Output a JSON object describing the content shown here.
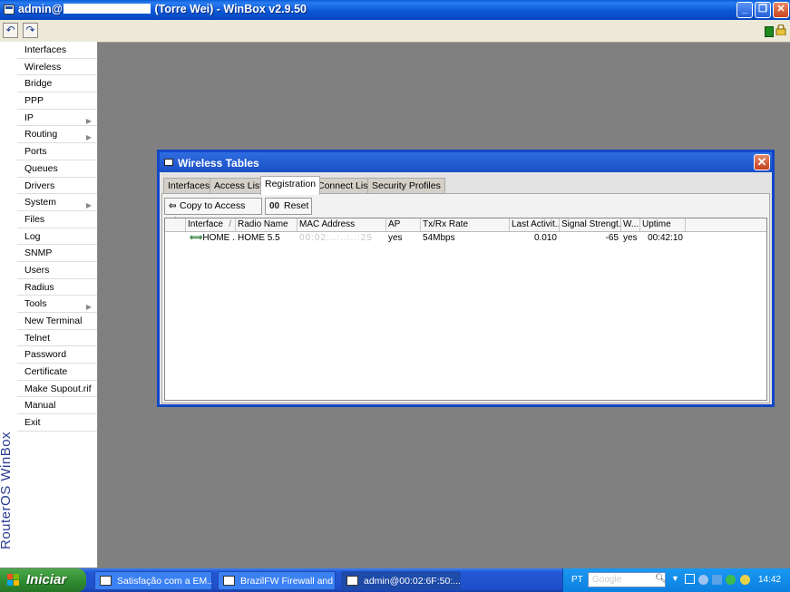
{
  "window": {
    "title_prefix": "admin@",
    "title_suffix": " (Torre Wei) - WinBox v2.9.50"
  },
  "toolbar": {
    "undo_glyph": "↶",
    "redo_glyph": "↷"
  },
  "brand": "RouterOS WinBox",
  "menu": [
    {
      "label": "Interfaces",
      "sub": false
    },
    {
      "label": "Wireless",
      "sub": false
    },
    {
      "label": "Bridge",
      "sub": false
    },
    {
      "label": "PPP",
      "sub": false
    },
    {
      "label": "IP",
      "sub": true
    },
    {
      "label": "Routing",
      "sub": true
    },
    {
      "label": "Ports",
      "sub": false
    },
    {
      "label": "Queues",
      "sub": false
    },
    {
      "label": "Drivers",
      "sub": false
    },
    {
      "label": "System",
      "sub": true
    },
    {
      "label": "Files",
      "sub": false
    },
    {
      "label": "Log",
      "sub": false
    },
    {
      "label": "SNMP",
      "sub": false
    },
    {
      "label": "Users",
      "sub": false
    },
    {
      "label": "Radius",
      "sub": false
    },
    {
      "label": "Tools",
      "sub": true
    },
    {
      "label": "New Terminal",
      "sub": false
    },
    {
      "label": "Telnet",
      "sub": false
    },
    {
      "label": "Password",
      "sub": false
    },
    {
      "label": "Certificate",
      "sub": false
    },
    {
      "label": "Make Supout.rif",
      "sub": false
    },
    {
      "label": "Manual",
      "sub": false
    },
    {
      "label": "Exit",
      "sub": false
    }
  ],
  "wireless": {
    "title": "Wireless Tables",
    "tabs": [
      "Interfaces",
      "Access List",
      "Registration",
      "Connect List",
      "Security Profiles"
    ],
    "active_tab": "Registration",
    "buttons": {
      "copy": "Copy to Access List",
      "reset": "Reset",
      "reset_icon": "00"
    },
    "columns": [
      "Interface",
      "Radio Name",
      "MAC Address",
      "AP",
      "Tx/Rx Rate",
      "Last Activit...",
      "Signal Strengt...",
      "W...",
      "Uptime"
    ],
    "rows": [
      {
        "interface": "HOME ...",
        "radio_name": "HOME 5.5",
        "mac": "00:02:..:..:..:25",
        "ap": "yes",
        "rate": "54Mbps",
        "last_activity": "0.010",
        "signal": "-65",
        "w": "yes",
        "uptime": "00:42:10"
      }
    ]
  },
  "taskbar": {
    "start": "Iniciar",
    "tasks": [
      {
        "label": "Satisfação com a EM...",
        "active": false
      },
      {
        "label": "BrazilFW Firewall and ...",
        "active": false
      },
      {
        "label": "admin@00:02:6F:50:...",
        "active": true
      }
    ],
    "lang": "PT",
    "search_placeholder": "Google",
    "clock": "14:42"
  }
}
